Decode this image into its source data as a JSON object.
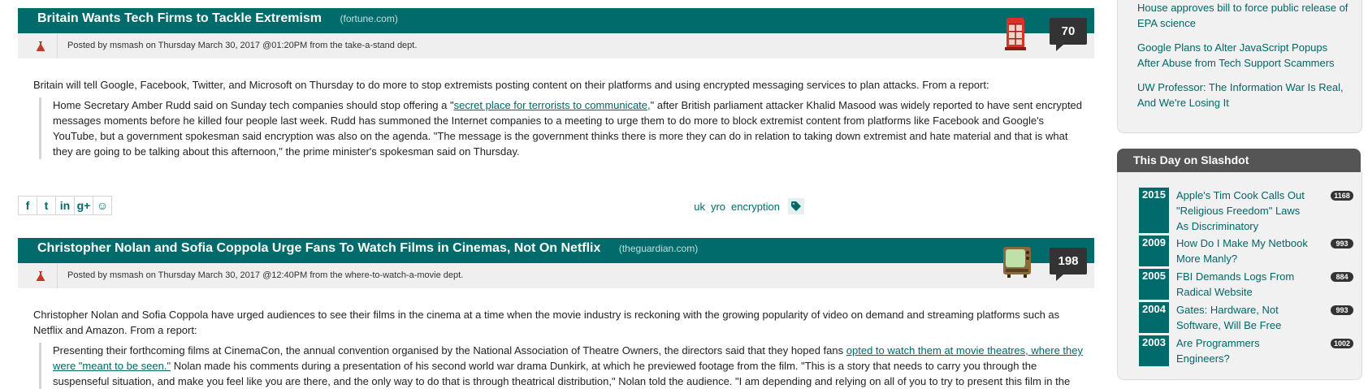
{
  "stories": [
    {
      "title": "Britain Wants Tech Firms to Tackle Extremism",
      "source": "(fortune.com)",
      "comments": "70",
      "topic_icon": "phone-booth-icon",
      "byline": "Posted by msmash on Thursday March 30, 2017 @01:20PM from the take-a-stand dept.",
      "intro": "Britain will tell Google, Facebook, Twitter, and Microsoft on Thursday to do more to stop extremists posting content on their platforms and using encrypted messaging services to plan attacks. From a report:",
      "quote_pre": "Home Secretary Amber Rudd said on Sunday tech companies should stop offering a \"",
      "quote_link": "secret place for terrorists to communicate,",
      "quote_post": "\" after British parliament attacker Khalid Masood was widely reported to have sent encrypted messages moments before he killed four people last week. Rudd has summoned the Internet companies to a meeting to urge them to do more to block extremist content from platforms like Facebook and Google's YouTube, but a government spokesman said encryption was also on the agenda. \"The message is the government thinks there is more they can do in relation to taking down extremist and hate material and that is what they are going to be talking about this afternoon,\" the prime minister's spokesman said on Thursday.",
      "tags": [
        "uk",
        "yro",
        "encryption"
      ]
    },
    {
      "title": "Christopher Nolan and Sofia Coppola Urge Fans To Watch Films in Cinemas, Not On Netflix",
      "source": "(theguardian.com)",
      "comments": "198",
      "topic_icon": "television-icon",
      "byline": "Posted by msmash on Thursday March 30, 2017 @12:40PM from the where-to-watch-a-movie dept.",
      "intro": "Christopher Nolan and Sofia Coppola have urged audiences to see their films in the cinema at a time when the movie industry is reckoning with the growing popularity of video on demand and streaming platforms such as Netflix and Amazon. From a report:",
      "quote_pre": "Presenting their forthcoming films at CinemaCon, the annual convention organised by the National Association of Theatre Owners, the directors said that they hoped fans ",
      "quote_link": "opted to watch them at movie theatres, where they were \"meant to be seen.\"",
      "quote_post": " Nolan made his comments during a presentation of his second world war drama Dunkirk, at which he previewed footage from the film. \"This is a story that needs to carry you through the suspenseful situation, and make you feel like you are there, and the only way to do that is through theatrical distribution,\" Nolan told the audience. \"I am depending and relying on all of you to try to present this film in the"
    }
  ],
  "share_icons": [
    "facebook-icon",
    "twitter-icon",
    "linkedin-icon",
    "google-plus-icon",
    "reddit-icon"
  ],
  "share_glyphs": [
    "f",
    "t",
    "in",
    "g+",
    "☺"
  ],
  "sidebar": {
    "links": [
      "House approves bill to force public release of EPA science",
      "Google Plans to Alter JavaScript Popups After Abuse from Tech Support Scammers",
      "UW Professor: The Information War Is Real, And We're Losing It"
    ],
    "this_day_title": "This Day on Slashdot",
    "this_day": [
      {
        "year": "2015",
        "title": "Apple's Tim Cook Calls Out \"Religious Freedom\" Laws As Discriminatory",
        "count": "1168"
      },
      {
        "year": "2009",
        "title": "How Do I Make My Netbook More Manly?",
        "count": "993"
      },
      {
        "year": "2005",
        "title": "FBI Demands Logs From Radical Website",
        "count": "884"
      },
      {
        "year": "2004",
        "title": "Gates: Hardware, Not Software, Will Be Free",
        "count": "993"
      },
      {
        "year": "2003",
        "title": "Are Programmers Engineers?",
        "count": "1002"
      }
    ]
  },
  "colors": {
    "header": "#016a6a",
    "link": "#006666",
    "sidebar_head": "#555555"
  }
}
